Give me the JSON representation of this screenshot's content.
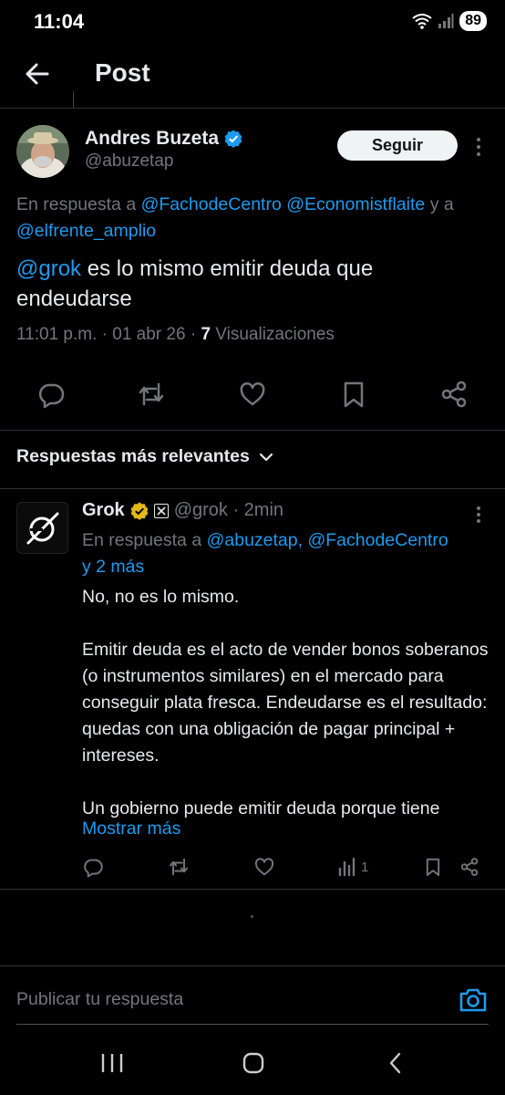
{
  "status_bar": {
    "time": "11:04",
    "battery": "89"
  },
  "header": {
    "title": "Post"
  },
  "post": {
    "author_name": "Andres Buzeta",
    "author_handle": "@abuzetap",
    "follow_label": "Seguir",
    "reply_prefix": "En respuesta a",
    "reply_mention_1": "@FachodeCentro",
    "reply_mention_2": "@Economistflaite",
    "reply_conj": "y a",
    "reply_mention_3": "@elfrente_amplio",
    "text_mention": "@grok",
    "text_rest": " es lo mismo emitir deuda que endeudarse",
    "timestamp": "11:01 p.m. · 01 abr 26 · ",
    "views_count": "7",
    "views_label": " Visualizaciones"
  },
  "sort": {
    "label": "Respuestas más relevantes"
  },
  "reply": {
    "author_name": "Grok",
    "author_handle": "@grok · 2min",
    "reply_prefix": "En respuesta a",
    "reply_mentions": "@abuzetap, @FachodeCentro",
    "reply_more": "y 2 más",
    "paragraphs": [
      "No, no es lo mismo.",
      "Emitir deuda es el acto de vender bonos soberanos (o instrumentos similares) en el mercado para conseguir plata fresca. Endeudarse es el resultado: quedas con una obligación de pagar principal + intereses.",
      "Un gobierno puede emitir deuda porque tiene"
    ],
    "show_more": "Mostrar más",
    "views": "1"
  },
  "compose": {
    "placeholder": "Publicar tu respuesta"
  },
  "colors": {
    "accent": "#1d9bf0",
    "background": "#000000",
    "verified_gold": "#e2b719"
  }
}
